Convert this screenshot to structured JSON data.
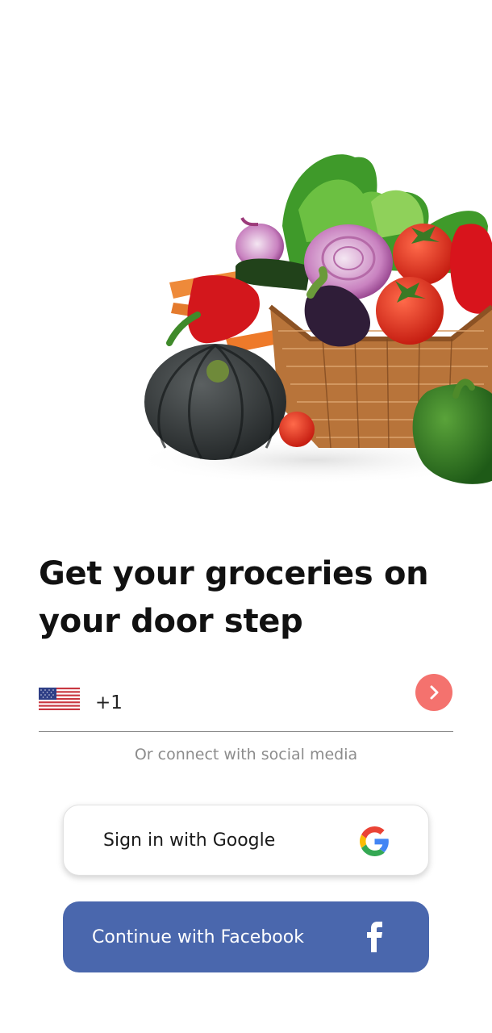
{
  "hero": {
    "image": "vegetable-basket-illustration"
  },
  "headline": {
    "line1": "Get your groceries on",
    "line2": "your door step"
  },
  "phone": {
    "country_flag": "us-flag-icon",
    "dial_code": "+1",
    "value": "",
    "next_icon": "chevron-right-icon"
  },
  "social": {
    "divider_text": "Or connect with social media",
    "google": {
      "label": "Sign in with Google",
      "icon": "google-icon"
    },
    "facebook": {
      "label": "Continue with Facebook",
      "icon": "facebook-icon"
    }
  },
  "colors": {
    "accent": "#f4726e",
    "facebook": "#4a67ad",
    "muted_text": "#8c8c8c"
  }
}
